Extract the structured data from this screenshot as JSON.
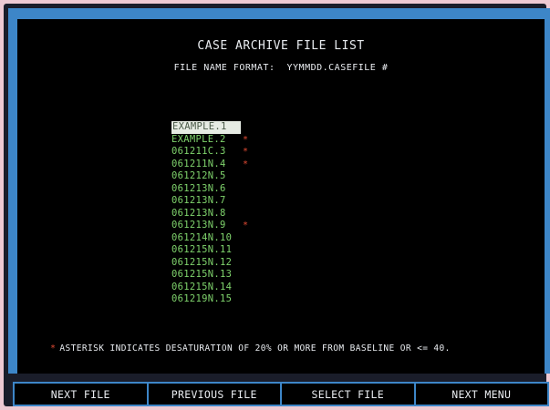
{
  "screen": {
    "title": "CASE ARCHIVE FILE LIST",
    "format_label": "FILE NAME FORMAT:",
    "format_value": "YYMMDD.CASEFILE #"
  },
  "files": [
    {
      "name": "EXAMPLE.1",
      "flagged": false,
      "selected": true
    },
    {
      "name": "EXAMPLE.2",
      "flagged": true,
      "selected": false
    },
    {
      "name": "061211C.3",
      "flagged": true,
      "selected": false
    },
    {
      "name": "061211N.4",
      "flagged": true,
      "selected": false
    },
    {
      "name": "061212N.5",
      "flagged": false,
      "selected": false
    },
    {
      "name": "061213N.6",
      "flagged": false,
      "selected": false
    },
    {
      "name": "061213N.7",
      "flagged": false,
      "selected": false
    },
    {
      "name": "061213N.8",
      "flagged": false,
      "selected": false
    },
    {
      "name": "061213N.9",
      "flagged": true,
      "selected": false
    },
    {
      "name": "061214N.10",
      "flagged": false,
      "selected": false
    },
    {
      "name": "061215N.11",
      "flagged": false,
      "selected": false
    },
    {
      "name": "061215N.12",
      "flagged": false,
      "selected": false
    },
    {
      "name": "061215N.13",
      "flagged": false,
      "selected": false
    },
    {
      "name": "061215N.14",
      "flagged": false,
      "selected": false
    },
    {
      "name": "061219N.15",
      "flagged": false,
      "selected": false
    }
  ],
  "flag_symbol": "*",
  "note": {
    "text": "ASTERISK INDICATES DESATURATION OF 20% OR MORE FROM BASELINE OR <= 40."
  },
  "softkeys": [
    {
      "label": "NEXT FILE"
    },
    {
      "label": "PREVIOUS FILE"
    },
    {
      "label": "SELECT FILE"
    },
    {
      "label": "NEXT MENU"
    }
  ],
  "colors": {
    "background": "#eecad3",
    "bezel": "#3d86c8",
    "screen": "#000000",
    "text": "#e9ecf0",
    "file_text": "#7fd36c",
    "flag": "#e04a33",
    "selection": "#e6ebe3"
  }
}
